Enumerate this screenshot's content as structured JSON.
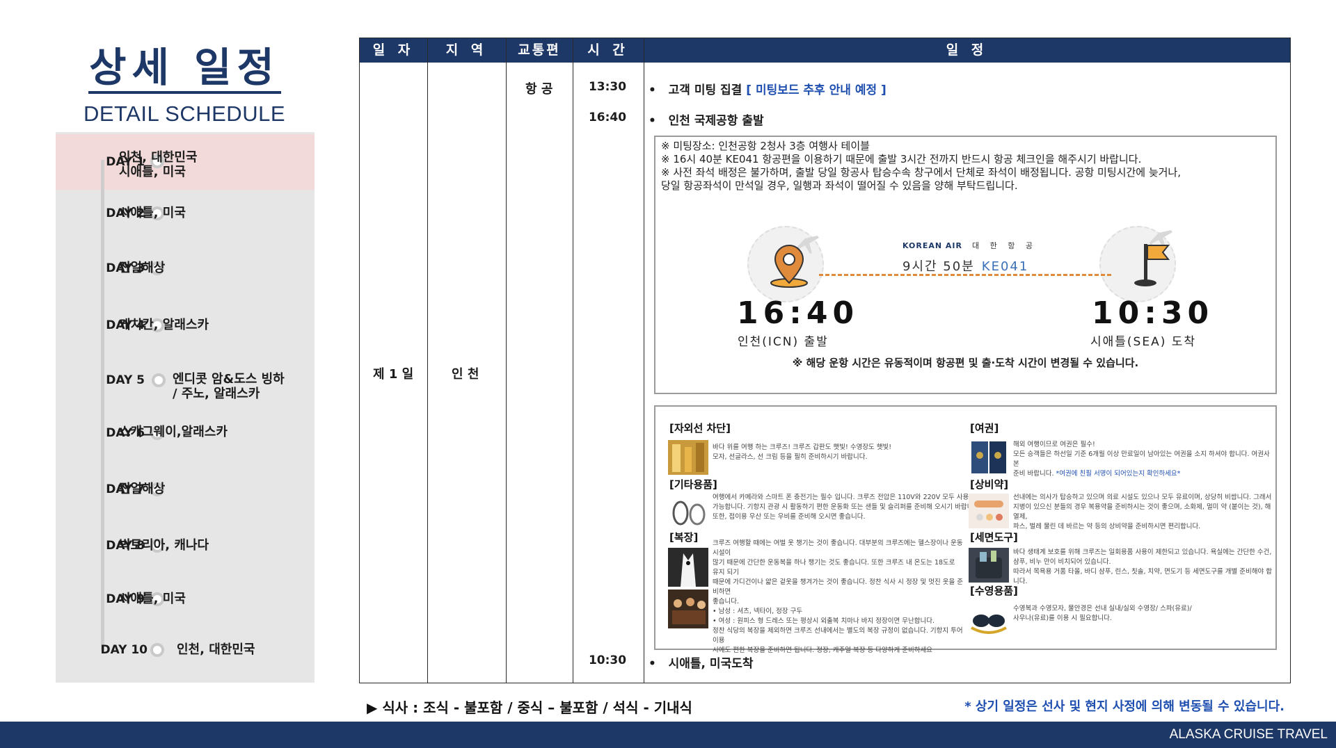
{
  "header": {
    "title_ko": "상세 일정",
    "title_en": "DETAIL SCHEDULE"
  },
  "days": [
    {
      "day": "DAY 1",
      "place": [
        "인천, 대한민국",
        "시애틀, 미국"
      ],
      "active": true
    },
    {
      "day": "DAY 2",
      "place": [
        "시애틀, 미국"
      ]
    },
    {
      "day": "DAY 3",
      "place": [
        "전일해상"
      ]
    },
    {
      "day": "DAY 4",
      "place": [
        "케치칸, 알래스카"
      ]
    },
    {
      "day": "DAY 5",
      "place": [
        "엔디콧 암&도스 빙하",
        "/ 주노, 알래스카"
      ]
    },
    {
      "day": "DAY 6",
      "place": [
        "스캐그웨이,알래스카"
      ]
    },
    {
      "day": "DAY 7",
      "place": [
        "전일해상"
      ]
    },
    {
      "day": "DAY 8",
      "place": [
        "빅토리아, 캐나다"
      ]
    },
    {
      "day": "DAY 9",
      "place": [
        "시애틀, 미국"
      ]
    },
    {
      "day": "DAY 10",
      "place": [
        "인천, 대한민국"
      ]
    }
  ],
  "table": {
    "headers": [
      "일 자",
      "지 역",
      "교통편",
      "시 간",
      "일 정"
    ],
    "day_cell": "제 1 일",
    "region_cell": "인 천",
    "transport_cell": "항 공",
    "rows": [
      {
        "time": "13:30",
        "bullet": "•",
        "text": "고객 미팅 집결",
        "highlight": "[ 미팅보드 추후 안내 예정 ]"
      },
      {
        "time": "16:40",
        "bullet": "•",
        "text": "인천 국제공항 출발"
      },
      {
        "time": "10:30",
        "bullet": "•",
        "text": "시애틀, 미국도착"
      }
    ]
  },
  "info": {
    "notes": [
      "※ 미팅장소: 인천공항 2청사 3층 여행사 테이블",
      "※ 16시 40분 KE041 항공편을 이용하기 때문에 출발 3시간 전까지 반드시 항공 체크인을 해주시기 바랍니다.",
      "※ 사전 좌석 배정은 불가하며, 출발 당일 항공사 탑승수속 창구에서 단체로 좌석이 배정됩니다. 공항 미팅시간에 늦거나,",
      "당일 항공좌석이 만석일 경우, 일행과 좌석이 떨어질 수 있음을 양해 부탁드립니다."
    ],
    "airline_en": "KOREAN AIR",
    "airline_ko": "대 한 항 공",
    "duration": "9시간 50분",
    "flight_code": "KE041",
    "depart_time": "16:40",
    "depart_label": "인천(ICN) 출발",
    "arrive_time": "10:30",
    "arrive_label": "시애틀(SEA) 도착",
    "disclaimer": "※ 해당 운항 시간은 유동적이며 항공편 및 출·도착 시간이 변경될 수 있습니다.",
    "colors": {
      "route": "#e08a3c",
      "pin": "#e08a3c",
      "flag": "#f2a93b"
    }
  },
  "tips": {
    "sun": {
      "title": "[자외선 차단]",
      "body": [
        "바다 위를 여행 하는 크루즈! 크루즈 갑판도 햇빛! 수영장도 햇빛!",
        "모자, 선글라스, 선 크림 등을 필히 준비하시기 바랍니다."
      ]
    },
    "misc": {
      "title": "[기타용품]",
      "body": [
        "여행에서 카메라와 스마트 폰 충전기는 필수 입니다. 크루즈 전압은 110V와 220V 모두 사용",
        "가능합니다. 기항지 관광 시 활동하기 편한 운동화 또는 샌들 및 슬리퍼를 준비해 오시기 바랍니다.",
        "또한, 접이용 우산 또는 우비를 준비해 오시면 좋습니다."
      ]
    },
    "dress": {
      "title": "[복장]",
      "body": [
        "크루즈 여행할 때에는 여벌 옷 챙기는 것이 좋습니다. 대부분의 크루즈에는 헬스장이나 운동시설이",
        "많기 때문에 간단한 운동복을 하나 챙기는 것도 좋습니다. 또한 크루즈 내 온도는 18도로 유지 되기",
        "때문에 가디건이나 얇은 겉옷을 챙겨가는 것이 좋습니다. 정찬 식사 시 정장 및 멋진 옷을 준비하면",
        "좋습니다.",
        "• 남성 : 셔츠, 넥타이, 정장 구두",
        "• 여성 : 원피스 형 드레스 또는 평상시 외출복 치마나 바지 정장이면 무난합니다.",
        "정찬 식당의 복장을 제외하면 크루즈 선내에서는 별도의 복장 규정이 없습니다. 기항지 투어 이용",
        "시에도 편한 복장을 준비하면 됩니다. 정장, 캐주얼 복장 등 다양하게 준비하세요"
      ]
    },
    "passport": {
      "title": "[여권]",
      "body": [
        "해외 여행이므로 여권은 필수!",
        "모든 승객들은 하선일 기준 6개월 이상 만료일이 남아있는 여권을 소지 하셔야 합니다. 여권사본",
        "준비 바랍니다."
      ],
      "highlight": "*여권에 친필 서명이 되어있는지 확인하세요*"
    },
    "medicine": {
      "title": "[상비약]",
      "body": [
        "선내에는 의사가 탑승하고 있으며 의료 시설도 있으나 모두 유료이며, 상당히 비쌉니다. 그래서",
        "지병이 있으신 분들의 경우 복용약을 준비하시는 것이 좋으며, 소화제, 멀미 약 (붙이는 것), 해열제,",
        "파스, 벌레 물린 데 바르는 약 등의 상비약을 준비하시면 편리합니다."
      ]
    },
    "toiletry": {
      "title": "[세면도구]",
      "body": [
        "바다 생태계 보호를 위해 크루즈는 일회용품 사용이 제한되고 있습니다. 욕실에는 간단한 수건,",
        "샴푸, 비누 만이 비치되어 있습니다.",
        "따라서 목욕용 거품 타올, 바디 샴푸, 린스, 칫솔, 치약, 면도기 등 세면도구를 개별 준비해야 합니다."
      ]
    },
    "swim": {
      "title": "[수영용품]",
      "body": [
        "수영복과 수영모자, 물안경은 선내 실내/실외 수영장/ 스파(유료)/",
        "사우나(유료)를 이용 시 필요합니다."
      ]
    }
  },
  "footer": {
    "meal": "▶ 식사 : 조식 - 불포함 / 중식 – 불포함 / 석식 - 기내식",
    "notice": "* 상기 일정은 선사 및 현지 사정에 의해 변동될 수 있습니다.",
    "brand": "ALASKA CRUISE TRAVEL"
  },
  "icons": [
    "location-pin-icon",
    "flag-icon",
    "airplane-icon"
  ],
  "colors": {
    "navy": "#1d3766",
    "accent_blue": "#1e4fb0",
    "active_day": "#f2dada",
    "panel": "#e6e6e6"
  }
}
